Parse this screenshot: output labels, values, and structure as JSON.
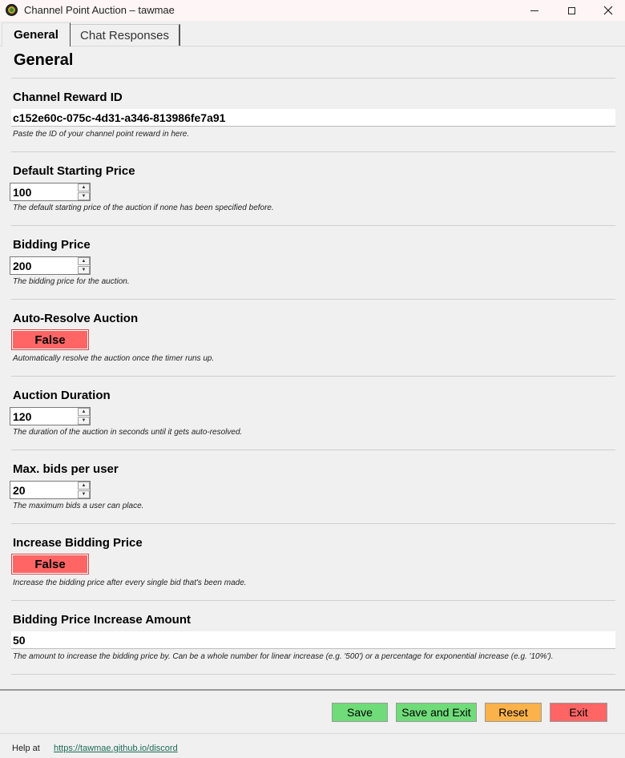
{
  "window": {
    "title": "Channel Point Auction – tawmae"
  },
  "tabs": [
    {
      "label": "General"
    },
    {
      "label": "Chat Responses"
    }
  ],
  "section": {
    "title": "General"
  },
  "fields": {
    "reward_id": {
      "label": "Channel Reward ID",
      "value": "c152e60c-075c-4d31-a346-813986fe7a91",
      "description": "Paste the ID of your channel point reward in here."
    },
    "start_price": {
      "label": "Default Starting Price",
      "value": "100",
      "description": "The default starting price of the auction if none has been specified before."
    },
    "bid_price": {
      "label": "Bidding Price",
      "value": "200",
      "description": "The bidding price for the auction."
    },
    "auto_resolve": {
      "label": "Auto-Resolve Auction",
      "value": "False",
      "description": "Automatically resolve the auction once the timer runs up."
    },
    "duration": {
      "label": "Auction Duration",
      "value": "120",
      "description": "The duration of the auction in seconds until it gets auto-resolved."
    },
    "max_bids": {
      "label": "Max. bids per user",
      "value": "20",
      "description": "The maximum bids a user can place."
    },
    "increase_bid": {
      "label": "Increase Bidding Price",
      "value": "False",
      "description": "Increase the bidding price after every single bid that's been made."
    },
    "increase_amount": {
      "label": "Bidding Price Increase Amount",
      "value": "50",
      "description": "The amount to increase the bidding price by. Can be a whole number for linear increase (e.g. '500') or a percentage for exponential increase (e.g. '10%')."
    }
  },
  "buttons": {
    "save": "Save",
    "save_exit": "Save and Exit",
    "reset": "Reset",
    "exit": "Exit"
  },
  "footer": {
    "help_label": "Help at",
    "help_link": "https://tawmae.github.io/discord"
  },
  "colors": {
    "false_toggle": "#ff6565",
    "save": "#6fdc79",
    "reset": "#fbb24a",
    "exit": "#ff6565"
  }
}
